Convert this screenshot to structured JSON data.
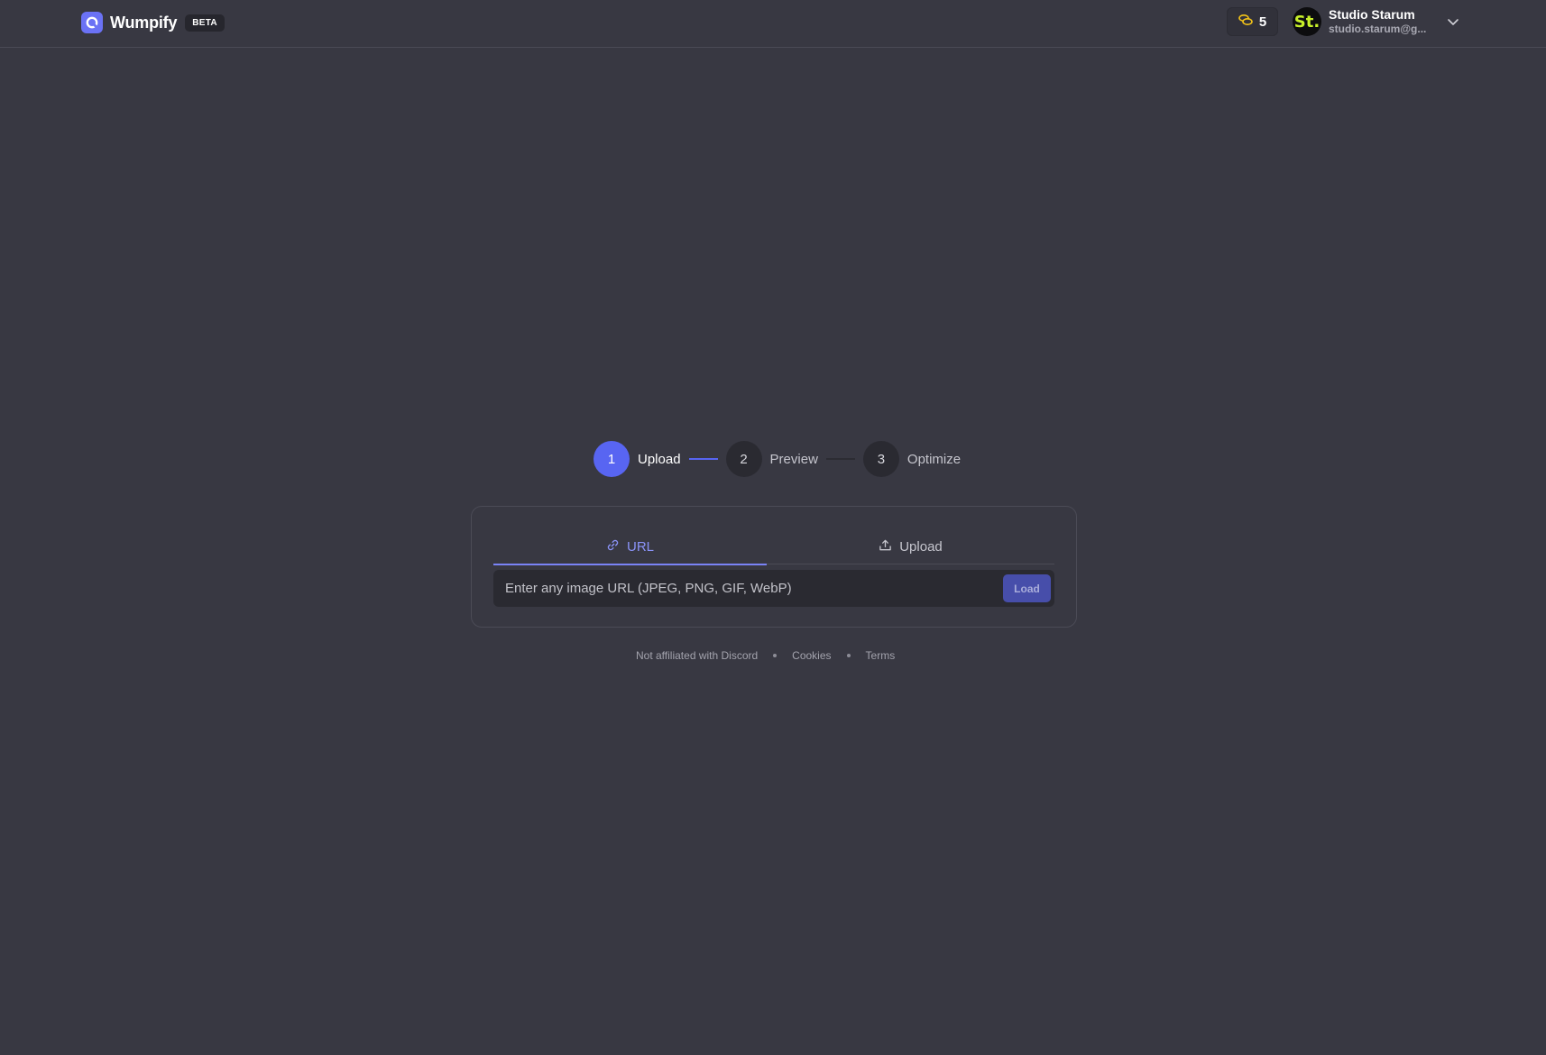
{
  "header": {
    "brand_name": "Wumpify",
    "badge": "BETA",
    "credits": "5",
    "user": {
      "avatar_initials": "St.",
      "name": "Studio Starum",
      "email": "studio.starum@g..."
    }
  },
  "stepper": {
    "steps": [
      {
        "number": "1",
        "label": "Upload",
        "active": true
      },
      {
        "number": "2",
        "label": "Preview",
        "active": false
      },
      {
        "number": "3",
        "label": "Optimize",
        "active": false
      }
    ]
  },
  "card": {
    "tabs": [
      {
        "label": "URL",
        "icon": "link-icon",
        "active": true
      },
      {
        "label": "Upload",
        "icon": "upload-icon",
        "active": false
      }
    ],
    "url_input": {
      "value": "",
      "placeholder": "Enter any image URL (JPEG, PNG, GIF, WebP)"
    },
    "load_label": "Load"
  },
  "footer": {
    "disclaimer": "Not affiliated with Discord",
    "cookies": "Cookies",
    "terms": "Terms"
  },
  "colors": {
    "background": "#383842",
    "accent": "#5865f2",
    "avatar_text": "#c8f02a",
    "coin": "#f5c518"
  }
}
